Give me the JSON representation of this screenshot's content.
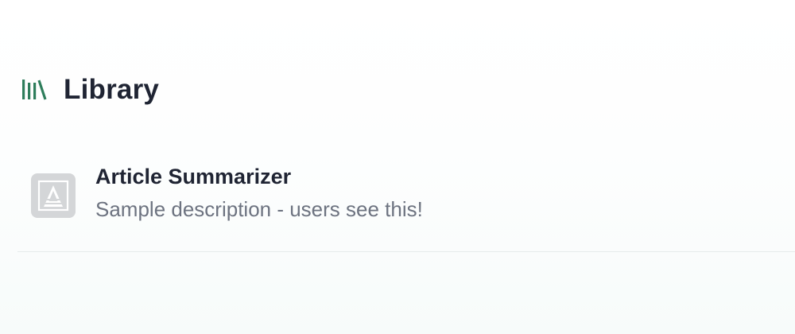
{
  "header": {
    "icon": "library-icon",
    "title": "Library"
  },
  "library": {
    "items": [
      {
        "icon": "app-placeholder-icon",
        "title": "Article Summarizer",
        "description": "Sample description - users see this!"
      }
    ]
  },
  "colors": {
    "accent": "#2e7d5b",
    "title_text": "#1f2433",
    "secondary_text": "#6d7380",
    "icon_background": "#d4d6d8",
    "divider": "#e6ebeb"
  }
}
